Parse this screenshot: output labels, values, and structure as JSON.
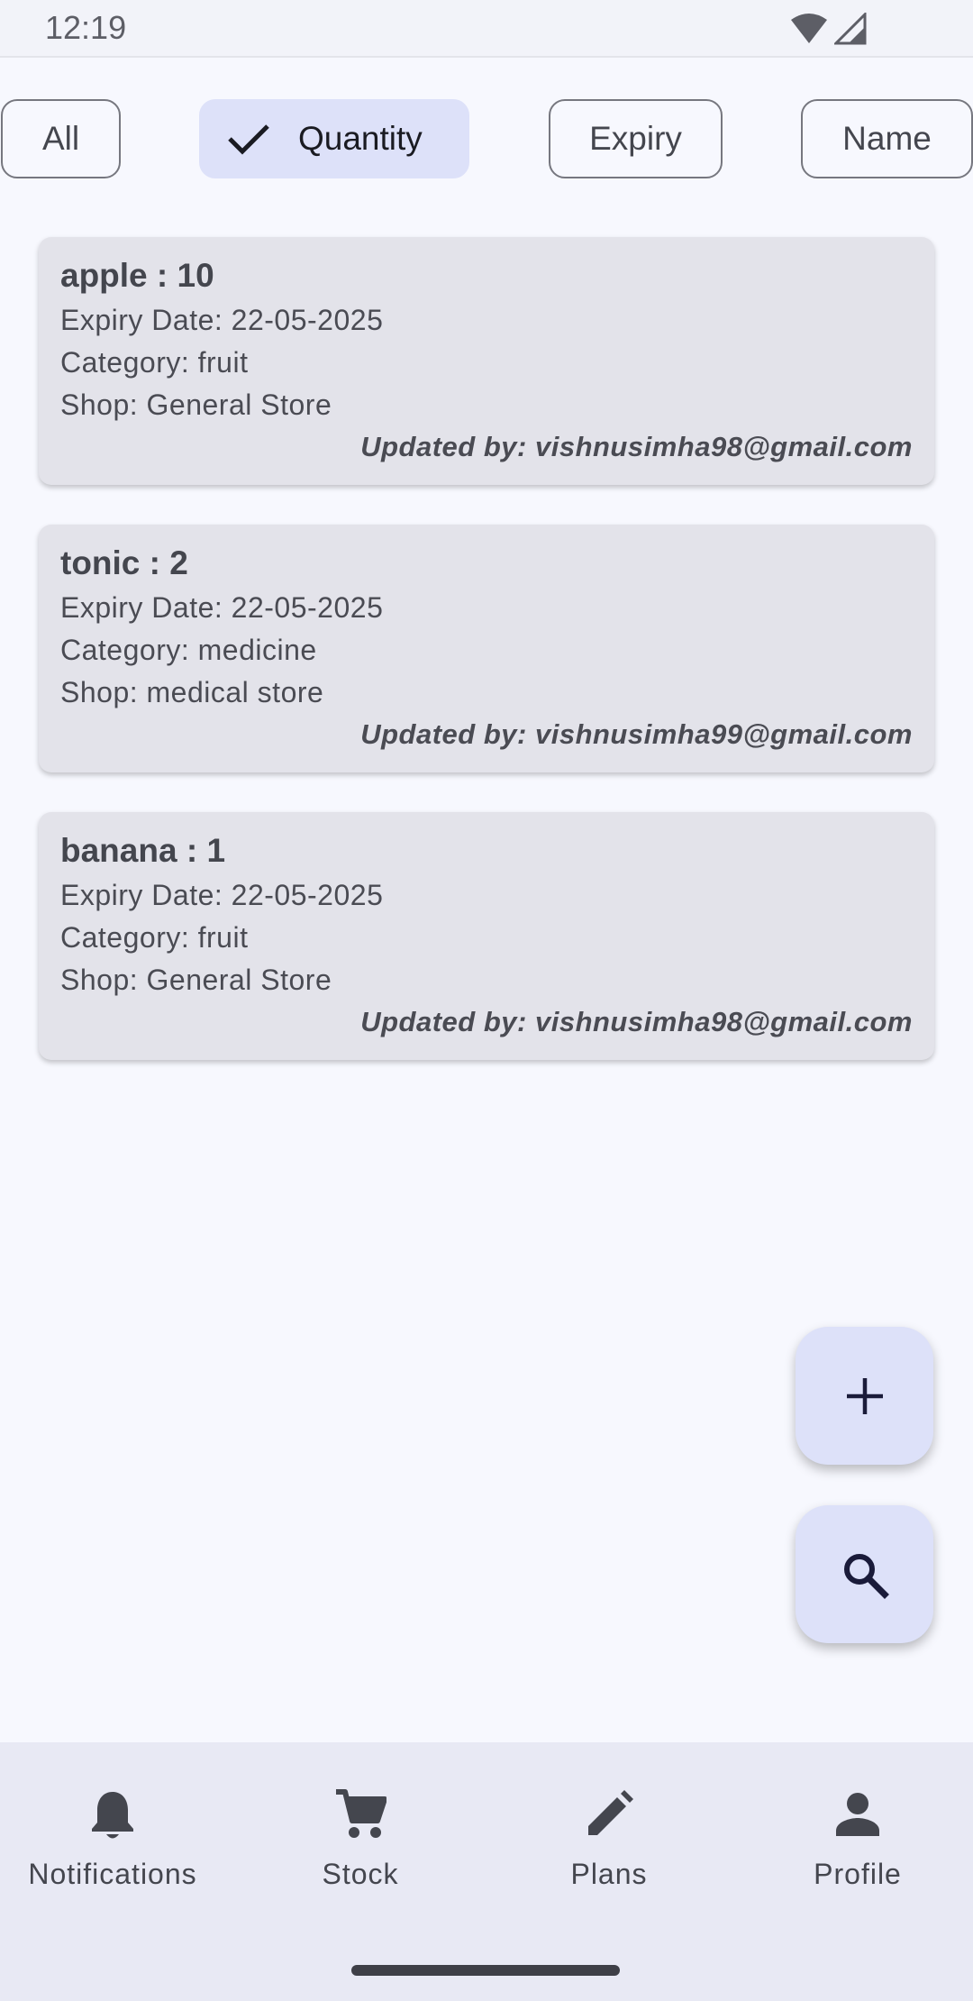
{
  "status_bar": {
    "time": "12:19"
  },
  "filters": {
    "chips": [
      {
        "label": "All",
        "selected": false
      },
      {
        "label": "Quantity",
        "selected": true
      },
      {
        "label": "Expiry",
        "selected": false
      },
      {
        "label": "Name",
        "selected": false
      }
    ]
  },
  "items": [
    {
      "name": "apple",
      "separator": " : ",
      "quantity": "10",
      "expiry_label": "Expiry Date: ",
      "expiry": "22-05-2025",
      "category_label": "Category: ",
      "category": "fruit",
      "shop_label": "Shop: ",
      "shop": "General Store",
      "updated_label": "Updated by: ",
      "updated_by": "vishnusimha98@gmail.com"
    },
    {
      "name": "tonic",
      "separator": " : ",
      "quantity": "2",
      "expiry_label": "Expiry Date: ",
      "expiry": "22-05-2025",
      "category_label": "Category: ",
      "category": "medicine",
      "shop_label": "Shop: ",
      "shop": "medical store",
      "updated_label": "Updated by: ",
      "updated_by": "vishnusimha99@gmail.com"
    },
    {
      "name": "banana",
      "separator": " : ",
      "quantity": "1",
      "expiry_label": "Expiry Date: ",
      "expiry": "22-05-2025",
      "category_label": "Category: ",
      "category": "fruit",
      "shop_label": "Shop: ",
      "shop": "General Store",
      "updated_label": "Updated by: ",
      "updated_by": "vishnusimha98@gmail.com"
    }
  ],
  "fabs": {
    "add_icon": "add-icon",
    "search_icon": "search-icon"
  },
  "bottom_nav": {
    "items": [
      {
        "label": "Notifications",
        "icon": "bell-icon"
      },
      {
        "label": "Stock",
        "icon": "cart-icon"
      },
      {
        "label": "Plans",
        "icon": "pencil-icon"
      },
      {
        "label": "Profile",
        "icon": "person-icon"
      }
    ]
  },
  "colors": {
    "background": "#f7f8fe",
    "card": "#e3e3ea",
    "selected_chip": "#dde1f9",
    "fab": "#dde1f9",
    "bottom_nav": "#e8e9f4"
  }
}
